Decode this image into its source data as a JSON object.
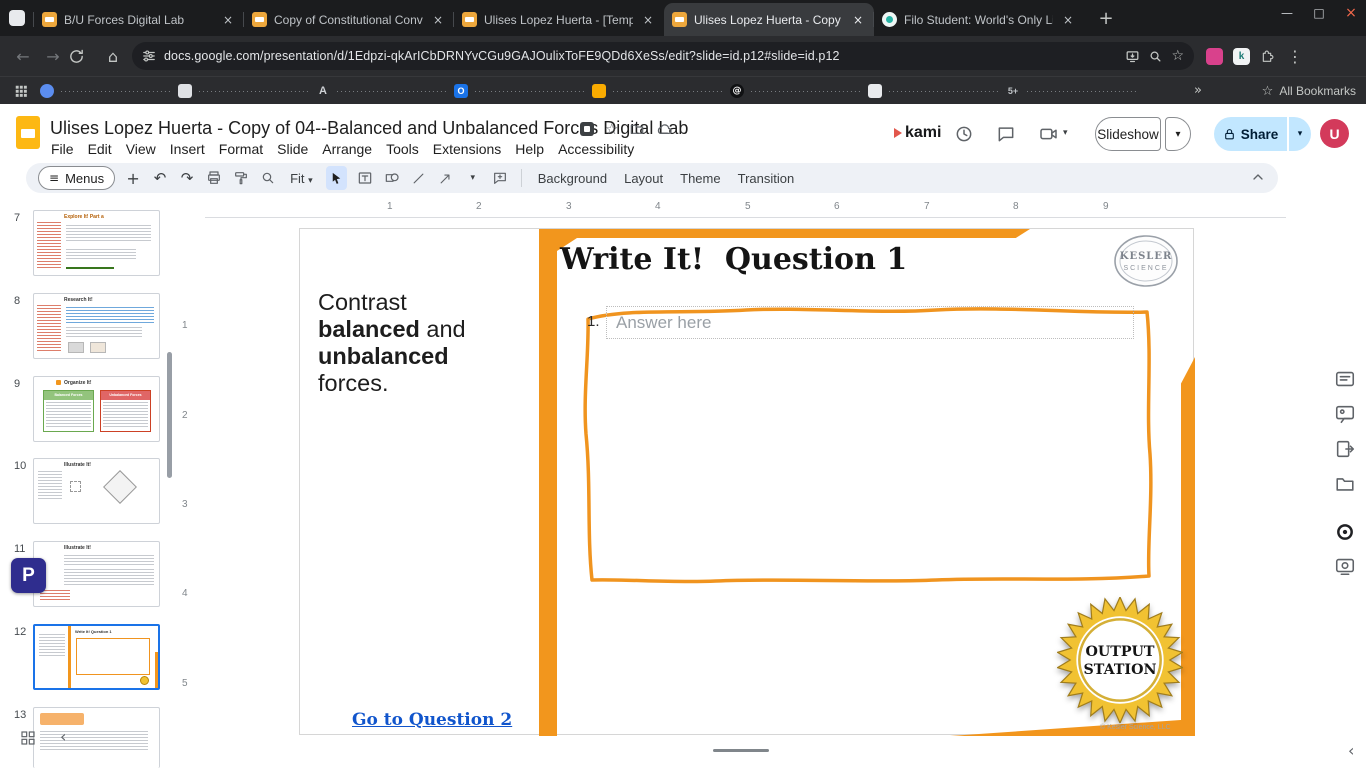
{
  "icons": {
    "close": "×",
    "minimize": "—",
    "maximize": "□",
    "new_tab": "+",
    "back": "←",
    "forward": "→",
    "home": "⌂",
    "star": "☆",
    "overflow": "»",
    "kebab": "⋮",
    "menu_burger": "≡",
    "undo": "↶",
    "redo": "↷",
    "caret_down": "▾",
    "chevron_left": "‹",
    "at": "@"
  },
  "browser": {
    "tabs": [
      {
        "title": "B/U Forces Digital Lab"
      },
      {
        "title": "Copy of Constitutional Conven"
      },
      {
        "title": "Ulises Lopez Huerta - [Templat"
      },
      {
        "title": "Ulises Lopez Huerta - Copy of C"
      },
      {
        "title": "Filo Student: World's Only Live I"
      }
    ],
    "url": "docs.google.com/presentation/d/1Edpzi-qkArICbDRNYvCGu9GAJOulixToFE9QDd6XeSs/edit?slide=id.p12#slide=id.p12",
    "all_bookmarks": "All Bookmarks",
    "bookmark_dots": "·····························································",
    "bookmark_glyphs": {
      "b3": "A",
      "b4": "O",
      "b8": "5+"
    }
  },
  "app": {
    "title": "Ulises Lopez Huerta - Copy of 04--Balanced and Unbalanced Forces Digital Lab",
    "menus": [
      "File",
      "Edit",
      "View",
      "Insert",
      "Format",
      "Slide",
      "Arrange",
      "Tools",
      "Extensions",
      "Help",
      "Accessibility"
    ],
    "kami_wordmark": "kami",
    "slideshow_label": "Slideshow",
    "share_label": "Share",
    "avatar_letter": "U"
  },
  "toolbar": {
    "menus_label": "Menus",
    "zoom_value": "Fit",
    "actions": [
      "Background",
      "Layout",
      "Theme",
      "Transition"
    ]
  },
  "rulers": {
    "h": [
      "1",
      "2",
      "3",
      "4",
      "5",
      "6",
      "7",
      "8",
      "9"
    ],
    "v": [
      "1",
      "2",
      "3",
      "4",
      "5"
    ]
  },
  "filmstrip": {
    "slides": [
      {
        "number": "7",
        "title": "Explore It!  Part a"
      },
      {
        "number": "8",
        "title": "Research It!"
      },
      {
        "number": "9",
        "title": "Organize It!",
        "table1": "Balanced Forces",
        "table2": "Unbalanced Forces"
      },
      {
        "number": "10",
        "title": "Illustrate It!"
      },
      {
        "number": "11",
        "title": "Illustrate It!"
      },
      {
        "number": "12",
        "title": "Write It!  Question 1"
      },
      {
        "number": "13",
        "title": ""
      }
    ]
  },
  "slide": {
    "title": "Write It!  Question 1",
    "prompt": {
      "pre": "Contrast ",
      "bold1": "balanced",
      "mid": " and ",
      "bold2": "unbalanced",
      "post": " forces."
    },
    "q_num": "1.",
    "answer_placeholder": "Answer here",
    "link": "Go to Question 2",
    "badge": {
      "line1": "OUTPUT",
      "line2": "STATION"
    },
    "seal": {
      "line1": "KESLER",
      "line2": "SCIENCE"
    },
    "copyright": "© Kesler Science, LLC",
    "accent_color": "#F2961D",
    "badge_gold": "#F1C232",
    "link_color": "#1155CC"
  },
  "kami_fab": {
    "label": "P"
  }
}
